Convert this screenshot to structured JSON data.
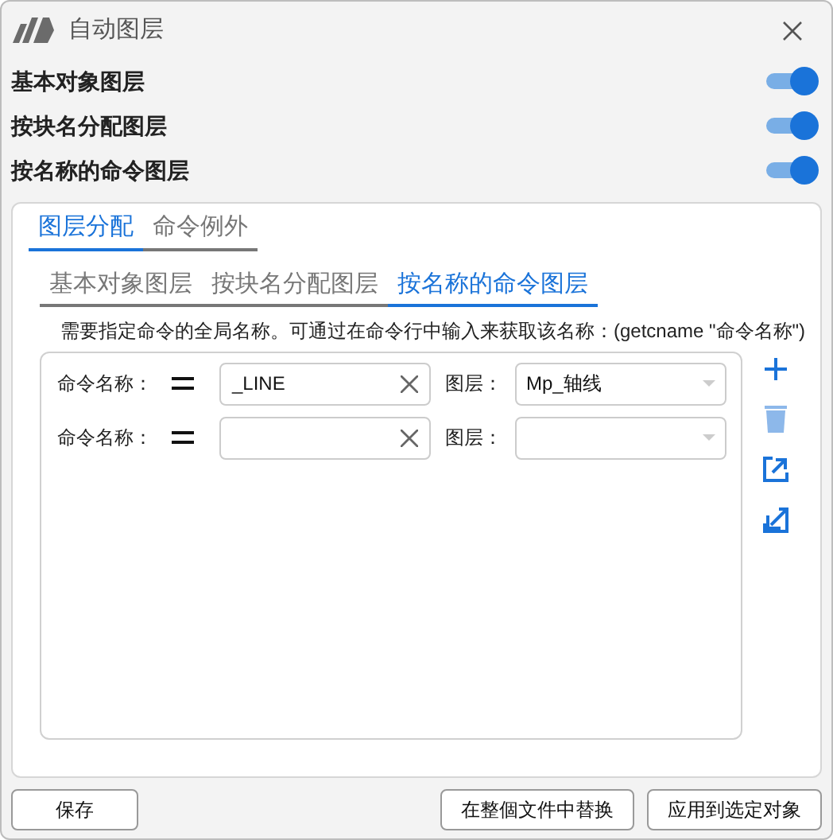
{
  "window": {
    "title": "自动图层"
  },
  "toggles": [
    {
      "label": "基本对象图层",
      "on": true
    },
    {
      "label": "按块名分配图层",
      "on": true
    },
    {
      "label": "按名称的命令图层",
      "on": true
    }
  ],
  "tabs": [
    {
      "label": "图层分配",
      "selected": true
    },
    {
      "label": "命令例外",
      "selected": false
    }
  ],
  "subtabs": [
    {
      "label": "基本对象图层",
      "selected": false
    },
    {
      "label": "按块名分配图层",
      "selected": false
    },
    {
      "label": "按名称的命令图层",
      "selected": true
    }
  ],
  "hint": "需要指定命令的全局名称。可通过在命令行中输入来获取该名称：(getcname \"命令名称\")",
  "rules": [
    {
      "name_label": "命令名称：",
      "command": "_LINE",
      "layer_label": "图层：",
      "layer": "Mp_轴线"
    },
    {
      "name_label": "命令名称：",
      "layer_label": "图层："
    }
  ],
  "buttons": {
    "left": [
      "保存"
    ],
    "right": [
      "在整個文件中替换",
      "应用到选定对象"
    ]
  }
}
